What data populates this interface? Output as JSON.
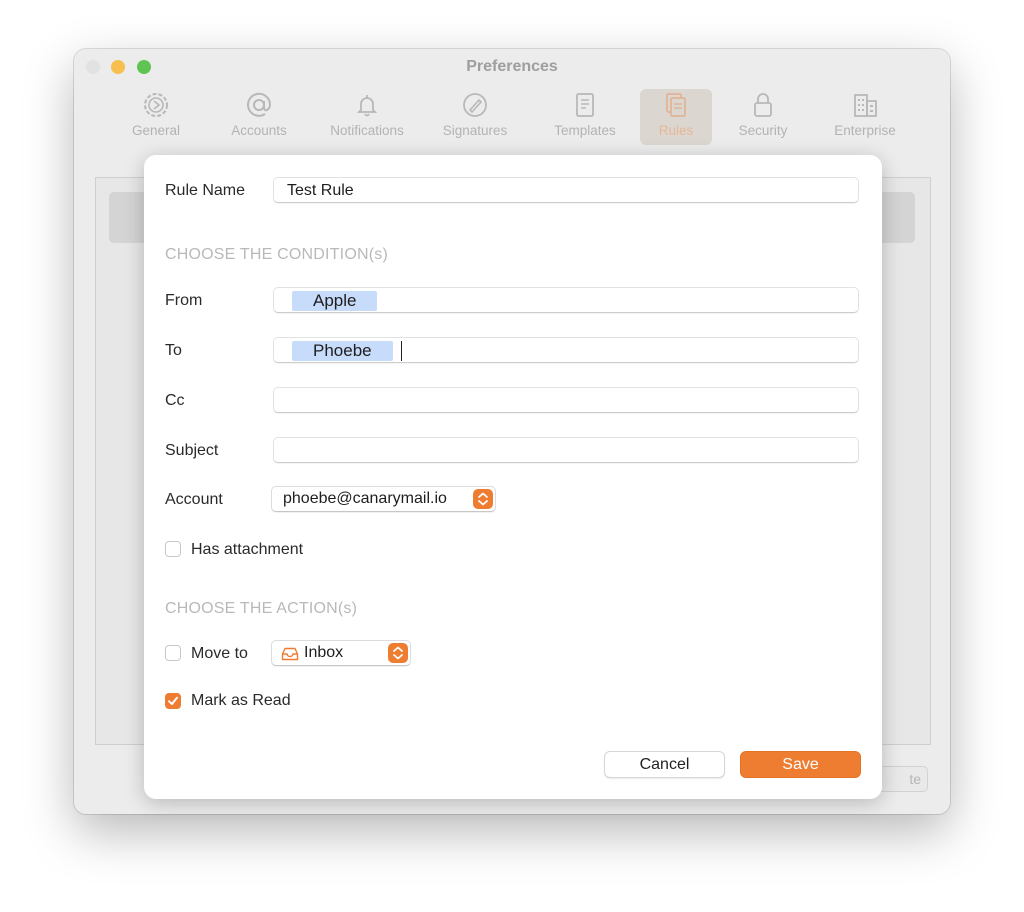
{
  "window": {
    "title": "Preferences"
  },
  "toolbar": {
    "items": [
      {
        "label": "General",
        "icon": "gear-icon"
      },
      {
        "label": "Accounts",
        "icon": "at-sign-icon"
      },
      {
        "label": "Notifications",
        "icon": "bell-icon"
      },
      {
        "label": "Signatures",
        "icon": "signature-icon"
      },
      {
        "label": "Templates",
        "icon": "document-icon"
      },
      {
        "label": "Rules",
        "icon": "rules-icon",
        "selected": true
      },
      {
        "label": "Security",
        "icon": "lock-icon"
      },
      {
        "label": "Enterprise",
        "icon": "building-icon"
      }
    ]
  },
  "background": {
    "bottom_button_fragment": "te"
  },
  "sheet": {
    "rule_name_label": "Rule Name",
    "rule_name_value": "Test Rule",
    "conditions_heading": "CHOOSE THE CONDITION(s)",
    "from_label": "From",
    "from_token": "Apple",
    "to_label": "To",
    "to_token": "Phoebe",
    "cc_label": "Cc",
    "cc_value": "",
    "subject_label": "Subject",
    "subject_value": "",
    "account_label": "Account",
    "account_value": "phoebe@canarymail.io",
    "has_attachment_label": "Has attachment",
    "has_attachment_checked": false,
    "actions_heading": "CHOOSE THE ACTION(s)",
    "move_to_label": "Move to",
    "move_to_checked": false,
    "move_to_folder": "Inbox",
    "mark_as_read_label": "Mark as Read",
    "mark_as_read_checked": true,
    "cancel_label": "Cancel",
    "save_label": "Save"
  },
  "colors": {
    "accent": "#ee7d31",
    "token_bg": "#c7dbfa"
  }
}
